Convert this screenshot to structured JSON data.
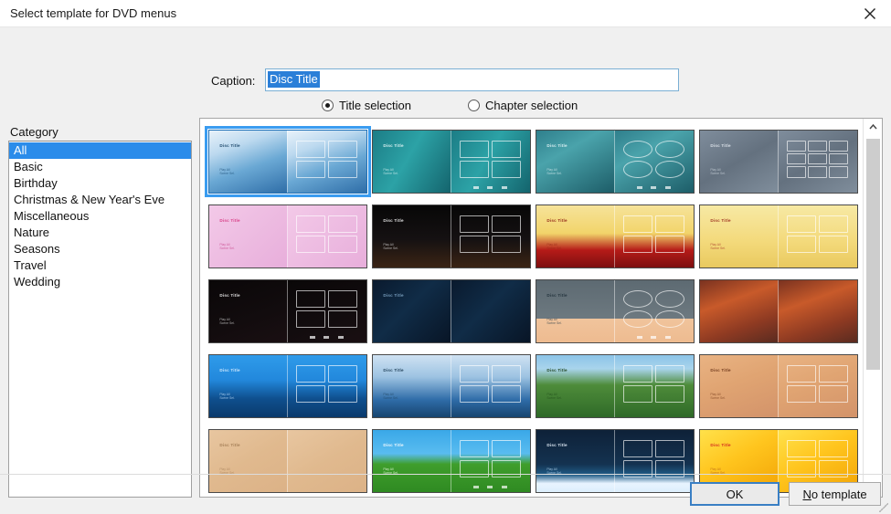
{
  "window": {
    "title": "Select template for DVD menus",
    "close_icon": "close-icon"
  },
  "caption": {
    "label": "Caption:",
    "value": "Disc Title",
    "placeholder": "Disc Title"
  },
  "selection_mode": {
    "options": [
      {
        "label": "Title selection",
        "selected": true
      },
      {
        "label": "Chapter selection",
        "selected": false
      }
    ]
  },
  "category": {
    "label": "Category",
    "items": [
      {
        "label": "All",
        "selected": true
      },
      {
        "label": "Basic",
        "selected": false
      },
      {
        "label": "Birthday",
        "selected": false
      },
      {
        "label": "Christmas & New Year's Eve",
        "selected": false
      },
      {
        "label": "Miscellaneous",
        "selected": false
      },
      {
        "label": "Nature",
        "selected": false
      },
      {
        "label": "Seasons",
        "selected": false
      },
      {
        "label": "Travel",
        "selected": false
      },
      {
        "label": "Wedding",
        "selected": false
      }
    ]
  },
  "templates": {
    "disc_title_text": "Disc Title",
    "sub_text": "Play All\nScene Sel.",
    "items": [
      {
        "name": "blue-waves",
        "selected": true,
        "bg": "linear-gradient(160deg,#e8f2fa 0%,#bcd9ef 28%,#6aa8d4 58%,#2f6ea8 100%)",
        "title_color": "#0d3a5e",
        "sub_color": "#1d4f78",
        "boxes": 4,
        "box_shape": "square",
        "nav": false,
        "title": true,
        "sub": true
      },
      {
        "name": "teal-gradient",
        "selected": false,
        "bg": "linear-gradient(120deg,#1c7d86 0%,#2ca2a6 45%,#14646d 100%)",
        "title_color": "#eafafa",
        "sub_color": "#cfeeee",
        "boxes": 4,
        "box_shape": "square",
        "nav": true,
        "title": true,
        "sub": true
      },
      {
        "name": "teal-clouds-circles",
        "selected": false,
        "bg": "linear-gradient(150deg,#2f7f8c 0%,#4aa3ab 35%,#1d5d68 100%)",
        "title_color": "#e6f6f8",
        "sub_color": "#cfe8eb",
        "boxes": 4,
        "box_shape": "round",
        "nav": true,
        "title": true,
        "sub": true
      },
      {
        "name": "slate-gray-nine",
        "selected": false,
        "bg": "linear-gradient(150deg,#7f8d9c 0%,#64717f 50%,#808e9c 100%)",
        "title_color": "#e2e8ee",
        "sub_color": "#ccd5dd",
        "boxes": 9,
        "box_shape": "square",
        "nav": false,
        "title": true,
        "sub": true
      },
      {
        "name": "pink-balloons",
        "selected": false,
        "bg": "linear-gradient(135deg,#f3c9e8 0%,#ecb9e0 60%,#e8aedb 100%)",
        "title_color": "#d6357f",
        "sub_color": "#c9468b",
        "boxes": 4,
        "box_shape": "square",
        "nav": false,
        "title": true,
        "sub": true
      },
      {
        "name": "birthday-cake-dark",
        "selected": false,
        "bg": "linear-gradient(180deg,#070707 0%,#151112 55%,#3b2414 100%)",
        "title_color": "#f2f2f2",
        "sub_color": "#d8d8d8",
        "boxes": 4,
        "box_shape": "square",
        "nav": false,
        "title": true,
        "sub": true
      },
      {
        "name": "christmas-red-gold",
        "selected": false,
        "bg": "linear-gradient(180deg,#f6e39a 0%,#f2d46a 45%,#b51b18 72%,#7d0f10 100%)",
        "title_color": "#8c1d12",
        "sub_color": "#9b2a18",
        "boxes": 4,
        "box_shape": "square",
        "nav": false,
        "title": true,
        "sub": true
      },
      {
        "name": "christmas-tree-gold",
        "selected": false,
        "bg": "linear-gradient(180deg,#f7e9a4 0%,#f3d97a 60%,#e9c95f 100%)",
        "title_color": "#9a2a1c",
        "sub_color": "#a8392a",
        "boxes": 4,
        "box_shape": "square",
        "nav": false,
        "title": true,
        "sub": true
      },
      {
        "name": "fireworks-black",
        "selected": false,
        "bg": "linear-gradient(160deg,#0a0708 0%,#120c0e 60%,#1a0f12 100%)",
        "title_color": "#f0f0f0",
        "sub_color": "#cfcfcf",
        "boxes": 4,
        "box_shape": "square",
        "nav": true,
        "title": true,
        "sub": true
      },
      {
        "name": "dark-blue-swirl",
        "selected": false,
        "bg": "linear-gradient(135deg,#0a1a2e 0%,#102c47 45%,#081526 100%)",
        "title_color": "#7fa6c6",
        "sub_color": "#6b93b4",
        "boxes": 0,
        "box_shape": "square",
        "nav": false,
        "title": true,
        "sub": false
      },
      {
        "name": "penguin-gray",
        "selected": false,
        "bg": "linear-gradient(180deg,#5d6a72 0%,#6d7980 62%,#f0c49c 62%,#eebb90 100%)",
        "title_color": "#20303a",
        "sub_color": "#32424c",
        "boxes": 4,
        "box_shape": "round",
        "nav": true,
        "title": true,
        "sub": true
      },
      {
        "name": "red-sunset-clouds",
        "selected": false,
        "bg": "linear-gradient(160deg,#7a3220 0%,#c85a2a 35%,#8e3a22 70%,#5a2b20 100%)",
        "title_color": "#ffe6d8",
        "sub_color": "#f3cdb8",
        "boxes": 0,
        "box_shape": "square",
        "nav": false,
        "title": false,
        "sub": false
      },
      {
        "name": "blue-winter-forest",
        "selected": false,
        "bg": "linear-gradient(180deg,#2f9bea 0%,#2288dc 40%,#0f4f8e 70%,#0a3a6c 100%)",
        "title_color": "#dceeff",
        "sub_color": "#bcdcf7",
        "boxes": 4,
        "box_shape": "square",
        "nav": false,
        "title": true,
        "sub": true
      },
      {
        "name": "frosted-branches",
        "selected": false,
        "bg": "linear-gradient(180deg,#cfe2f2 0%,#9dc3e2 35%,#2f6ca8 72%,#17456f 100%)",
        "title_color": "#16364f",
        "sub_color": "#234a68",
        "boxes": 4,
        "box_shape": "square",
        "nav": false,
        "title": true,
        "sub": true
      },
      {
        "name": "green-park-trees",
        "selected": false,
        "bg": "linear-gradient(180deg,#8cc4e8 0%,#a9d4ec 22%,#4e8c3a 48%,#2f6a28 100%)",
        "title_color": "#163a10",
        "sub_color": "#23501c",
        "boxes": 4,
        "box_shape": "square",
        "nav": false,
        "title": true,
        "sub": true
      },
      {
        "name": "autumn-parchment",
        "selected": false,
        "bg": "linear-gradient(160deg,#e9b383 0%,#e0a472 45%,#d3936a 100%)",
        "title_color": "#6b3418",
        "sub_color": "#7c4220",
        "boxes": 4,
        "box_shape": "square",
        "nav": false,
        "title": true,
        "sub": true
      },
      {
        "name": "sand-texture",
        "selected": false,
        "bg": "linear-gradient(150deg,#e8c6a0 0%,#e0b98e 50%,#dcb287 100%)",
        "title_color": "#a07a52",
        "sub_color": "#ab855e",
        "boxes": 0,
        "box_shape": "square",
        "nav": false,
        "title": true,
        "sub": true
      },
      {
        "name": "cartoon-meadow",
        "selected": false,
        "bg": "linear-gradient(180deg,#3aa8e8 0%,#59bcf0 38%,#3f9e2c 55%,#2f8a22 100%)",
        "title_color": "#ffffff",
        "sub_color": "#f0ffe8",
        "boxes": 4,
        "box_shape": "square",
        "nav": true,
        "title": true,
        "sub": true
      },
      {
        "name": "winter-night-snow",
        "selected": false,
        "bg": "linear-gradient(180deg,#0e2138 0%,#143250 55%,#1f5b86 72%,#e8f4ff 86%,#dceefc 100%)",
        "title_color": "#eaf4ff",
        "sub_color": "#b9d6ef",
        "boxes": 4,
        "box_shape": "square",
        "nav": false,
        "title": true,
        "sub": true
      },
      {
        "name": "golden-rays",
        "selected": false,
        "bg": "linear-gradient(150deg,#ffe14a 0%,#ffc51e 45%,#f2a406 100%)",
        "title_color": "#d01f1f",
        "sub_color": "#b8651a",
        "boxes": 4,
        "box_shape": "square",
        "nav": true,
        "title": true,
        "sub": true
      }
    ]
  },
  "scrollbar": {
    "up_icon": "chevron-up-icon",
    "down_icon": "chevron-down-icon"
  },
  "footer": {
    "ok_label": "OK",
    "no_template_label": "No template",
    "no_template_mnemonic": "N",
    "no_template_rest": "o template"
  }
}
